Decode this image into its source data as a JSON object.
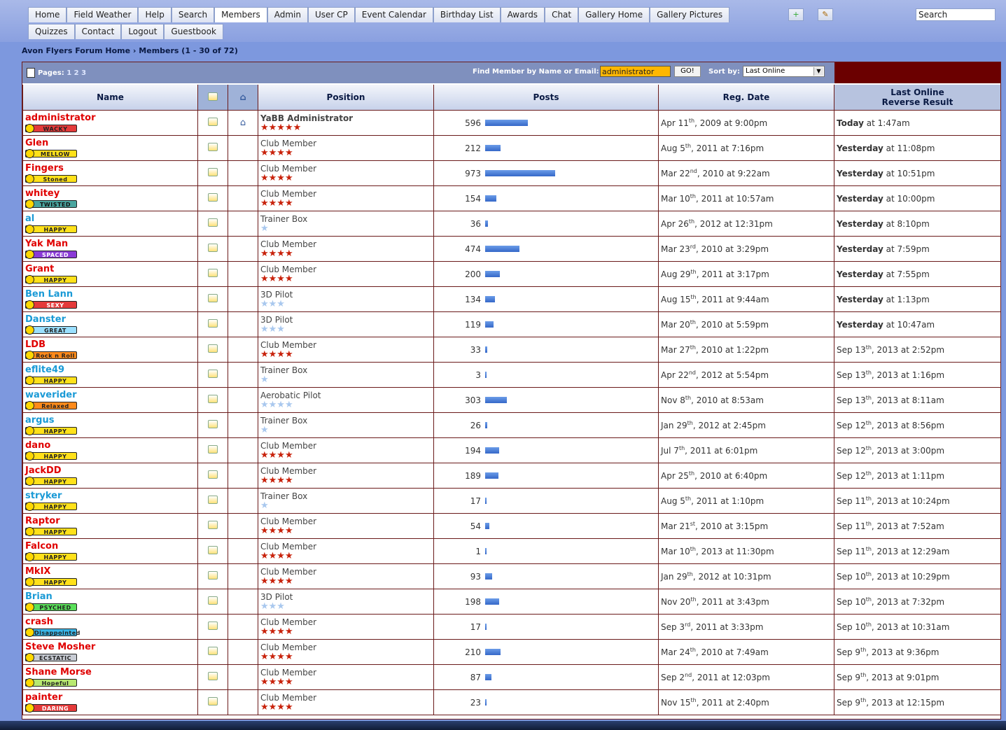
{
  "nav": {
    "row1": [
      "Home",
      "Field Weather",
      "Help",
      "Search",
      "Members",
      "Admin",
      "User CP",
      "Event Calendar",
      "Birthday List",
      "Awards",
      "Chat",
      "Gallery Home",
      "Gallery Pictures"
    ],
    "row2": [
      "Quizzes",
      "Contact",
      "Logout",
      "Guestbook"
    ],
    "active": "Members",
    "search_label": "Search"
  },
  "breadcrumb": {
    "home": "Avon Flyers Forum Home",
    "sep": " › ",
    "current": "Members (1 - 30 of 72)"
  },
  "toolbar": {
    "pages_label": "Pages:",
    "pages": [
      "1",
      "2",
      "3"
    ],
    "find_label": "Find Member by Name or Email:",
    "find_value": "administrator",
    "go_label": "GO!",
    "sort_label": "Sort by:",
    "sort_value": "Last Online"
  },
  "table": {
    "headers": {
      "name": "Name",
      "position": "Position",
      "posts": "Posts",
      "reg_date": "Reg. Date",
      "last_online_1": "Last Online",
      "last_online_2": "Reverse Result"
    },
    "rows": [
      {
        "name": "administrator",
        "name_color": "#e00000",
        "mood": "WACKY",
        "mood_bg": "#e43a3a",
        "mood_fg": "#222",
        "position": "YaBB Administrator",
        "stars": "★★★★★",
        "star_type": "red",
        "home": true,
        "posts": 596,
        "reg": "Apr 11",
        "reg_sup": "th",
        "reg_rest": ", 2009 at 9:00pm",
        "last_bold": "Today",
        "last_rest": " at 1:47am",
        "last_sup": "",
        "last_tail": ""
      },
      {
        "name": "Glen",
        "name_color": "#e00000",
        "mood": "MELLOW",
        "mood_bg": "#ffe11a",
        "mood_fg": "#222",
        "position": "Club Member",
        "stars": "★★★★",
        "star_type": "red",
        "home": false,
        "posts": 212,
        "reg": "Aug 5",
        "reg_sup": "th",
        "reg_rest": ", 2011 at 7:16pm",
        "last_bold": "Yesterday",
        "last_rest": " at 11:08pm",
        "last_sup": "",
        "last_tail": ""
      },
      {
        "name": "Fingers",
        "name_color": "#e00000",
        "mood": "Stoned",
        "mood_bg": "#ffe11a",
        "mood_fg": "#222",
        "position": "Club Member",
        "stars": "★★★★",
        "star_type": "red",
        "home": false,
        "posts": 973,
        "reg": "Mar 22",
        "reg_sup": "nd",
        "reg_rest": ", 2010 at 9:22am",
        "last_bold": "Yesterday",
        "last_rest": " at 10:51pm",
        "last_sup": "",
        "last_tail": ""
      },
      {
        "name": "whitey",
        "name_color": "#e00000",
        "mood": "TWISTED",
        "mood_bg": "#4aa6a0",
        "mood_fg": "#111",
        "position": "Club Member",
        "stars": "★★★★",
        "star_type": "red",
        "home": false,
        "posts": 154,
        "reg": "Mar 10",
        "reg_sup": "th",
        "reg_rest": ", 2011 at 10:57am",
        "last_bold": "Yesterday",
        "last_rest": " at 10:00pm",
        "last_sup": "",
        "last_tail": ""
      },
      {
        "name": "al",
        "name_color": "#1a9ad6",
        "mood": "HAPPY",
        "mood_bg": "#ffe11a",
        "mood_fg": "#222",
        "position": "Trainer Box",
        "stars": "★",
        "star_type": "blue",
        "home": false,
        "posts": 36,
        "reg": "Apr 26",
        "reg_sup": "th",
        "reg_rest": ", 2012 at 12:31pm",
        "last_bold": "Yesterday",
        "last_rest": " at 8:10pm",
        "last_sup": "",
        "last_tail": ""
      },
      {
        "name": "Yak Man",
        "name_color": "#e00000",
        "mood": "SPACED",
        "mood_bg": "#8a3ad6",
        "mood_fg": "#fff",
        "position": "Club Member",
        "stars": "★★★★",
        "star_type": "red",
        "home": false,
        "posts": 474,
        "reg": "Mar 23",
        "reg_sup": "rd",
        "reg_rest": ", 2010 at 3:29pm",
        "last_bold": "Yesterday",
        "last_rest": " at 7:59pm",
        "last_sup": "",
        "last_tail": ""
      },
      {
        "name": "Grant",
        "name_color": "#e00000",
        "mood": "HAPPY",
        "mood_bg": "#ffe11a",
        "mood_fg": "#222",
        "position": "Club Member",
        "stars": "★★★★",
        "star_type": "red",
        "home": false,
        "posts": 200,
        "reg": "Aug 29",
        "reg_sup": "th",
        "reg_rest": ", 2011 at 3:17pm",
        "last_bold": "Yesterday",
        "last_rest": " at 7:55pm",
        "last_sup": "",
        "last_tail": ""
      },
      {
        "name": "Ben Lann",
        "name_color": "#1a9ad6",
        "mood": "SEXY",
        "mood_bg": "#e43a3a",
        "mood_fg": "#fff",
        "position": "3D Pilot",
        "stars": "★★★",
        "star_type": "blue",
        "home": false,
        "posts": 134,
        "reg": "Aug 15",
        "reg_sup": "th",
        "reg_rest": ", 2011 at 9:44am",
        "last_bold": "Yesterday",
        "last_rest": " at 1:13pm",
        "last_sup": "",
        "last_tail": ""
      },
      {
        "name": "Danster",
        "name_color": "#1a9ad6",
        "mood": "GREAT",
        "mood_bg": "#9be0ff",
        "mood_fg": "#222",
        "position": "3D Pilot",
        "stars": "★★★",
        "star_type": "blue",
        "home": false,
        "posts": 119,
        "reg": "Mar 20",
        "reg_sup": "th",
        "reg_rest": ", 2010 at 5:59pm",
        "last_bold": "Yesterday",
        "last_rest": " at 10:47am",
        "last_sup": "",
        "last_tail": ""
      },
      {
        "name": "LDB",
        "name_color": "#e00000",
        "mood": "Rock n Roll",
        "mood_bg": "#ff8a1a",
        "mood_fg": "#222",
        "position": "Club Member",
        "stars": "★★★★",
        "star_type": "red",
        "home": false,
        "posts": 33,
        "reg": "Mar 27",
        "reg_sup": "th",
        "reg_rest": ", 2010 at 1:22pm",
        "last_bold": "",
        "last_rest": "Sep 13",
        "last_sup": "th",
        "last_tail": ", 2013 at 2:52pm"
      },
      {
        "name": "eflite49",
        "name_color": "#1a9ad6",
        "mood": "HAPPY",
        "mood_bg": "#ffe11a",
        "mood_fg": "#222",
        "position": "Trainer Box",
        "stars": "★",
        "star_type": "blue",
        "home": false,
        "posts": 3,
        "reg": "Apr 22",
        "reg_sup": "nd",
        "reg_rest": ", 2012 at 5:54pm",
        "last_bold": "",
        "last_rest": "Sep 13",
        "last_sup": "th",
        "last_tail": ", 2013 at 1:16pm"
      },
      {
        "name": "waverider",
        "name_color": "#1a9ad6",
        "mood": "Relaxed",
        "mood_bg": "#ff8a1a",
        "mood_fg": "#222",
        "position": "Aerobatic Pilot",
        "stars": "★★★★",
        "star_type": "blue",
        "home": false,
        "posts": 303,
        "reg": "Nov 8",
        "reg_sup": "th",
        "reg_rest": ", 2010 at 8:53am",
        "last_bold": "",
        "last_rest": "Sep 13",
        "last_sup": "th",
        "last_tail": ", 2013 at 8:11am"
      },
      {
        "name": "argus",
        "name_color": "#1a9ad6",
        "mood": "HAPPY",
        "mood_bg": "#ffe11a",
        "mood_fg": "#222",
        "position": "Trainer Box",
        "stars": "★",
        "star_type": "blue",
        "home": false,
        "posts": 26,
        "reg": "Jan 29",
        "reg_sup": "th",
        "reg_rest": ", 2012 at 2:45pm",
        "last_bold": "",
        "last_rest": "Sep 12",
        "last_sup": "th",
        "last_tail": ", 2013 at 8:56pm"
      },
      {
        "name": "dano",
        "name_color": "#e00000",
        "mood": "HAPPY",
        "mood_bg": "#ffe11a",
        "mood_fg": "#222",
        "position": "Club Member",
        "stars": "★★★★",
        "star_type": "red",
        "home": false,
        "posts": 194,
        "reg": "Jul 7",
        "reg_sup": "th",
        "reg_rest": ", 2011 at 6:01pm",
        "last_bold": "",
        "last_rest": "Sep 12",
        "last_sup": "th",
        "last_tail": ", 2013 at 3:00pm"
      },
      {
        "name": "JackDD",
        "name_color": "#e00000",
        "mood": "HAPPY",
        "mood_bg": "#ffe11a",
        "mood_fg": "#222",
        "position": "Club Member",
        "stars": "★★★★",
        "star_type": "red",
        "home": false,
        "posts": 189,
        "reg": "Apr 25",
        "reg_sup": "th",
        "reg_rest": ", 2010 at 6:40pm",
        "last_bold": "",
        "last_rest": "Sep 12",
        "last_sup": "th",
        "last_tail": ", 2013 at 1:11pm"
      },
      {
        "name": "stryker",
        "name_color": "#1a9ad6",
        "mood": "HAPPY",
        "mood_bg": "#ffe11a",
        "mood_fg": "#222",
        "position": "Trainer Box",
        "stars": "★",
        "star_type": "blue",
        "home": false,
        "posts": 17,
        "reg": "Aug 5",
        "reg_sup": "th",
        "reg_rest": ", 2011 at 1:10pm",
        "last_bold": "",
        "last_rest": "Sep 11",
        "last_sup": "th",
        "last_tail": ", 2013 at 10:24pm"
      },
      {
        "name": "Raptor",
        "name_color": "#e00000",
        "mood": "HAPPY",
        "mood_bg": "#ffe11a",
        "mood_fg": "#222",
        "position": "Club Member",
        "stars": "★★★★",
        "star_type": "red",
        "home": false,
        "posts": 54,
        "reg": "Mar 21",
        "reg_sup": "st",
        "reg_rest": ", 2010 at 3:15pm",
        "last_bold": "",
        "last_rest": "Sep 11",
        "last_sup": "th",
        "last_tail": ", 2013 at 7:52am"
      },
      {
        "name": "Falcon",
        "name_color": "#e00000",
        "mood": "HAPPY",
        "mood_bg": "#ffe11a",
        "mood_fg": "#222",
        "position": "Club Member",
        "stars": "★★★★",
        "star_type": "red",
        "home": false,
        "posts": 1,
        "reg": "Mar 10",
        "reg_sup": "th",
        "reg_rest": ", 2013 at 11:30pm",
        "last_bold": "",
        "last_rest": "Sep 11",
        "last_sup": "th",
        "last_tail": ", 2013 at 12:29am"
      },
      {
        "name": "MkIX",
        "name_color": "#e00000",
        "mood": "HAPPY",
        "mood_bg": "#ffe11a",
        "mood_fg": "#222",
        "position": "Club Member",
        "stars": "★★★★",
        "star_type": "red",
        "home": false,
        "posts": 93,
        "reg": "Jan 29",
        "reg_sup": "th",
        "reg_rest": ", 2012 at 10:31pm",
        "last_bold": "",
        "last_rest": "Sep 10",
        "last_sup": "th",
        "last_tail": ", 2013 at 10:29pm"
      },
      {
        "name": "Brian",
        "name_color": "#1a9ad6",
        "mood": "PSYCHED",
        "mood_bg": "#5ae05a",
        "mood_fg": "#222",
        "position": "3D Pilot",
        "stars": "★★★",
        "star_type": "blue",
        "home": false,
        "posts": 198,
        "reg": "Nov 20",
        "reg_sup": "th",
        "reg_rest": ", 2011 at 3:43pm",
        "last_bold": "",
        "last_rest": "Sep 10",
        "last_sup": "th",
        "last_tail": ", 2013 at 7:32pm"
      },
      {
        "name": "crash",
        "name_color": "#e00000",
        "mood": "Disappointed",
        "mood_bg": "#3ab6e8",
        "mood_fg": "#222",
        "position": "Club Member",
        "stars": "★★★★",
        "star_type": "red",
        "home": false,
        "posts": 17,
        "reg": "Sep 3",
        "reg_sup": "rd",
        "reg_rest": ", 2011 at 3:33pm",
        "last_bold": "",
        "last_rest": "Sep 10",
        "last_sup": "th",
        "last_tail": ", 2013 at 10:31am"
      },
      {
        "name": "Steve Mosher",
        "name_color": "#e00000",
        "mood": "ECSTATIC",
        "mood_bg": "#c8ccd4",
        "mood_fg": "#222",
        "position": "Club Member",
        "stars": "★★★★",
        "star_type": "red",
        "home": false,
        "posts": 210,
        "reg": "Mar 24",
        "reg_sup": "th",
        "reg_rest": ", 2010 at 7:49am",
        "last_bold": "",
        "last_rest": "Sep 9",
        "last_sup": "th",
        "last_tail": ", 2013 at 9:36pm"
      },
      {
        "name": "Shane Morse",
        "name_color": "#e00000",
        "mood": "Hopeful",
        "mood_bg": "#b8e870",
        "mood_fg": "#222",
        "position": "Club Member",
        "stars": "★★★★",
        "star_type": "red",
        "home": false,
        "posts": 87,
        "reg": "Sep 2",
        "reg_sup": "nd",
        "reg_rest": ", 2011 at 12:03pm",
        "last_bold": "",
        "last_rest": "Sep 9",
        "last_sup": "th",
        "last_tail": ", 2013 at 9:01pm"
      },
      {
        "name": "painter",
        "name_color": "#e00000",
        "mood": "DARING",
        "mood_bg": "#e43a3a",
        "mood_fg": "#fff",
        "position": "Club Member",
        "stars": "★★★★",
        "star_type": "red",
        "home": false,
        "posts": 23,
        "reg": "Nov 15",
        "reg_sup": "th",
        "reg_rest": ", 2011 at 2:40pm",
        "last_bold": "",
        "last_rest": "Sep 9",
        "last_sup": "th",
        "last_tail": ", 2013 at 12:15pm"
      }
    ]
  }
}
